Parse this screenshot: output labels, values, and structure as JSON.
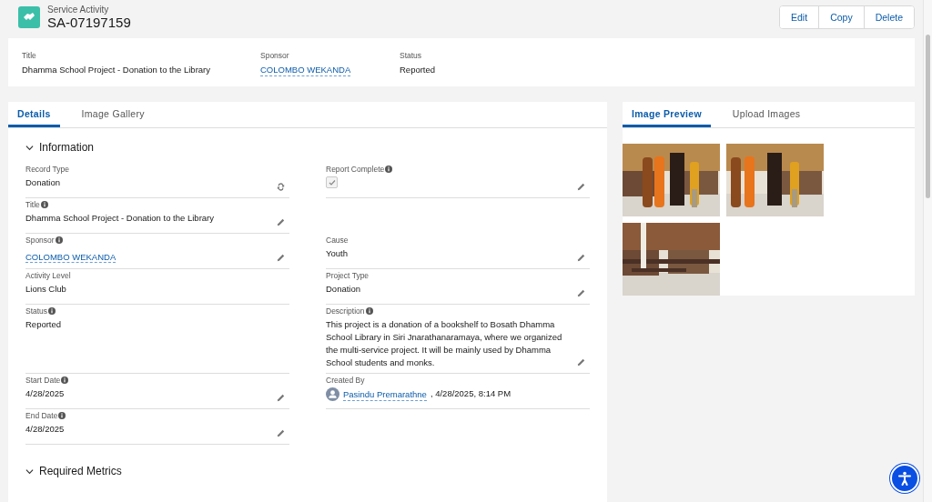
{
  "header": {
    "object_type": "Service Activity",
    "record_name": "SA-07197159",
    "actions": [
      "Edit",
      "Copy",
      "Delete"
    ]
  },
  "highlights": [
    {
      "label": "Title",
      "value": "Dhamma School Project - Donation to the Library",
      "kind": "text"
    },
    {
      "label": "Sponsor",
      "value": "COLOMBO WEKANDA",
      "kind": "link"
    },
    {
      "label": "Status",
      "value": "Reported",
      "kind": "text"
    }
  ],
  "detail_tabs": [
    {
      "label": "Details",
      "selected": true
    },
    {
      "label": "Image Gallery",
      "selected": false
    }
  ],
  "sections": [
    {
      "title": "Information",
      "expanded": true,
      "rows": [
        [
          {
            "label": "Record Type",
            "info": false,
            "kind": "text",
            "value": "Donation",
            "editable": false,
            "changeable": true
          },
          {
            "label": "Report Complete",
            "info": true,
            "kind": "checkbox",
            "checked": true,
            "editable": true,
            "changeable": false
          }
        ],
        [
          {
            "label": "Title",
            "info": true,
            "kind": "text",
            "value": "Dhamma School Project - Donation to the Library",
            "editable": true,
            "changeable": false
          }
        ],
        [
          {
            "label": "Sponsor",
            "info": true,
            "kind": "link",
            "value": "COLOMBO WEKANDA",
            "editable": true,
            "changeable": false
          },
          {
            "label": "Cause",
            "info": false,
            "kind": "text",
            "value": "Youth",
            "editable": true,
            "changeable": false
          }
        ],
        [
          {
            "label": "Activity Level",
            "info": false,
            "kind": "text",
            "value": "Lions Club",
            "editable": false,
            "changeable": false
          },
          {
            "label": "Project Type",
            "info": false,
            "kind": "text",
            "value": "Donation",
            "editable": true,
            "changeable": false
          }
        ],
        [
          {
            "label": "Status",
            "info": true,
            "kind": "text",
            "value": "Reported",
            "editable": false,
            "changeable": false
          },
          {
            "label": "Description",
            "info": true,
            "kind": "text",
            "value": "This project is a donation of a bookshelf to Bosath Dhamma School Library in Siri Jnarathanaramaya, where we organized the multi-service project. It will be mainly used by Dhamma School students and monks.",
            "editable": true,
            "changeable": false
          }
        ],
        [
          {
            "label": "Start Date",
            "info": true,
            "kind": "text",
            "value": "4/28/2025",
            "editable": true,
            "changeable": false
          },
          {
            "label": "Created By",
            "info": false,
            "kind": "user",
            "user": "Pasindu Premarathne",
            "value": ", 4/28/2025, 8:14 PM",
            "editable": false,
            "changeable": false
          }
        ],
        [
          {
            "label": "End Date",
            "info": true,
            "kind": "text",
            "value": "4/28/2025",
            "editable": true,
            "changeable": false
          }
        ]
      ]
    },
    {
      "title": "Required Metrics",
      "expanded": true
    }
  ],
  "image_tabs": [
    {
      "label": "Image Preview",
      "selected": true
    },
    {
      "label": "Upload Images",
      "selected": false
    }
  ]
}
